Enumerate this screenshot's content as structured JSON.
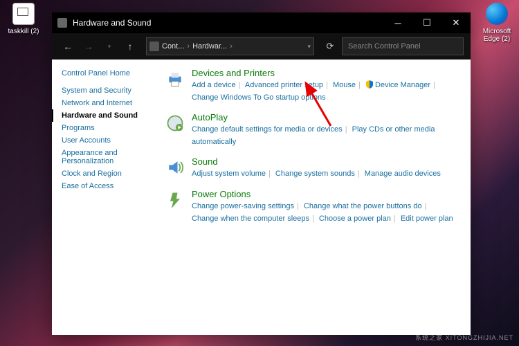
{
  "desktop": {
    "icon1": "taskkill (2)",
    "icon2": "Microsoft Edge (2)"
  },
  "window": {
    "title": "Hardware and Sound"
  },
  "addr": {
    "seg1": "Cont...",
    "seg2": "Hardwar..."
  },
  "search": {
    "placeholder": "Search Control Panel"
  },
  "sidebar": {
    "header": "Control Panel Home",
    "items": {
      "i0": "System and Security",
      "i1": "Network and Internet",
      "i2": "Hardware and Sound",
      "i3": "Programs",
      "i4": "User Accounts",
      "i5": "Appearance and Personalization",
      "i6": "Clock and Region",
      "i7": "Ease of Access"
    }
  },
  "cats": {
    "devices": {
      "title": "Devices and Printers",
      "l0": "Add a device",
      "l1": "Advanced printer setup",
      "l2": "Mouse",
      "l3": "Device Manager",
      "l4": "Change Windows To Go startup options"
    },
    "autoplay": {
      "title": "AutoPlay",
      "l0": "Change default settings for media or devices",
      "l1": "Play CDs or other media automatically"
    },
    "sound": {
      "title": "Sound",
      "l0": "Adjust system volume",
      "l1": "Change system sounds",
      "l2": "Manage audio devices"
    },
    "power": {
      "title": "Power Options",
      "l0": "Change power-saving settings",
      "l1": "Change what the power buttons do",
      "l2": "Change when the computer sleeps",
      "l3": "Choose a power plan",
      "l4": "Edit power plan"
    }
  },
  "watermark": "系统之家  XITONGZHIJIA.NET"
}
